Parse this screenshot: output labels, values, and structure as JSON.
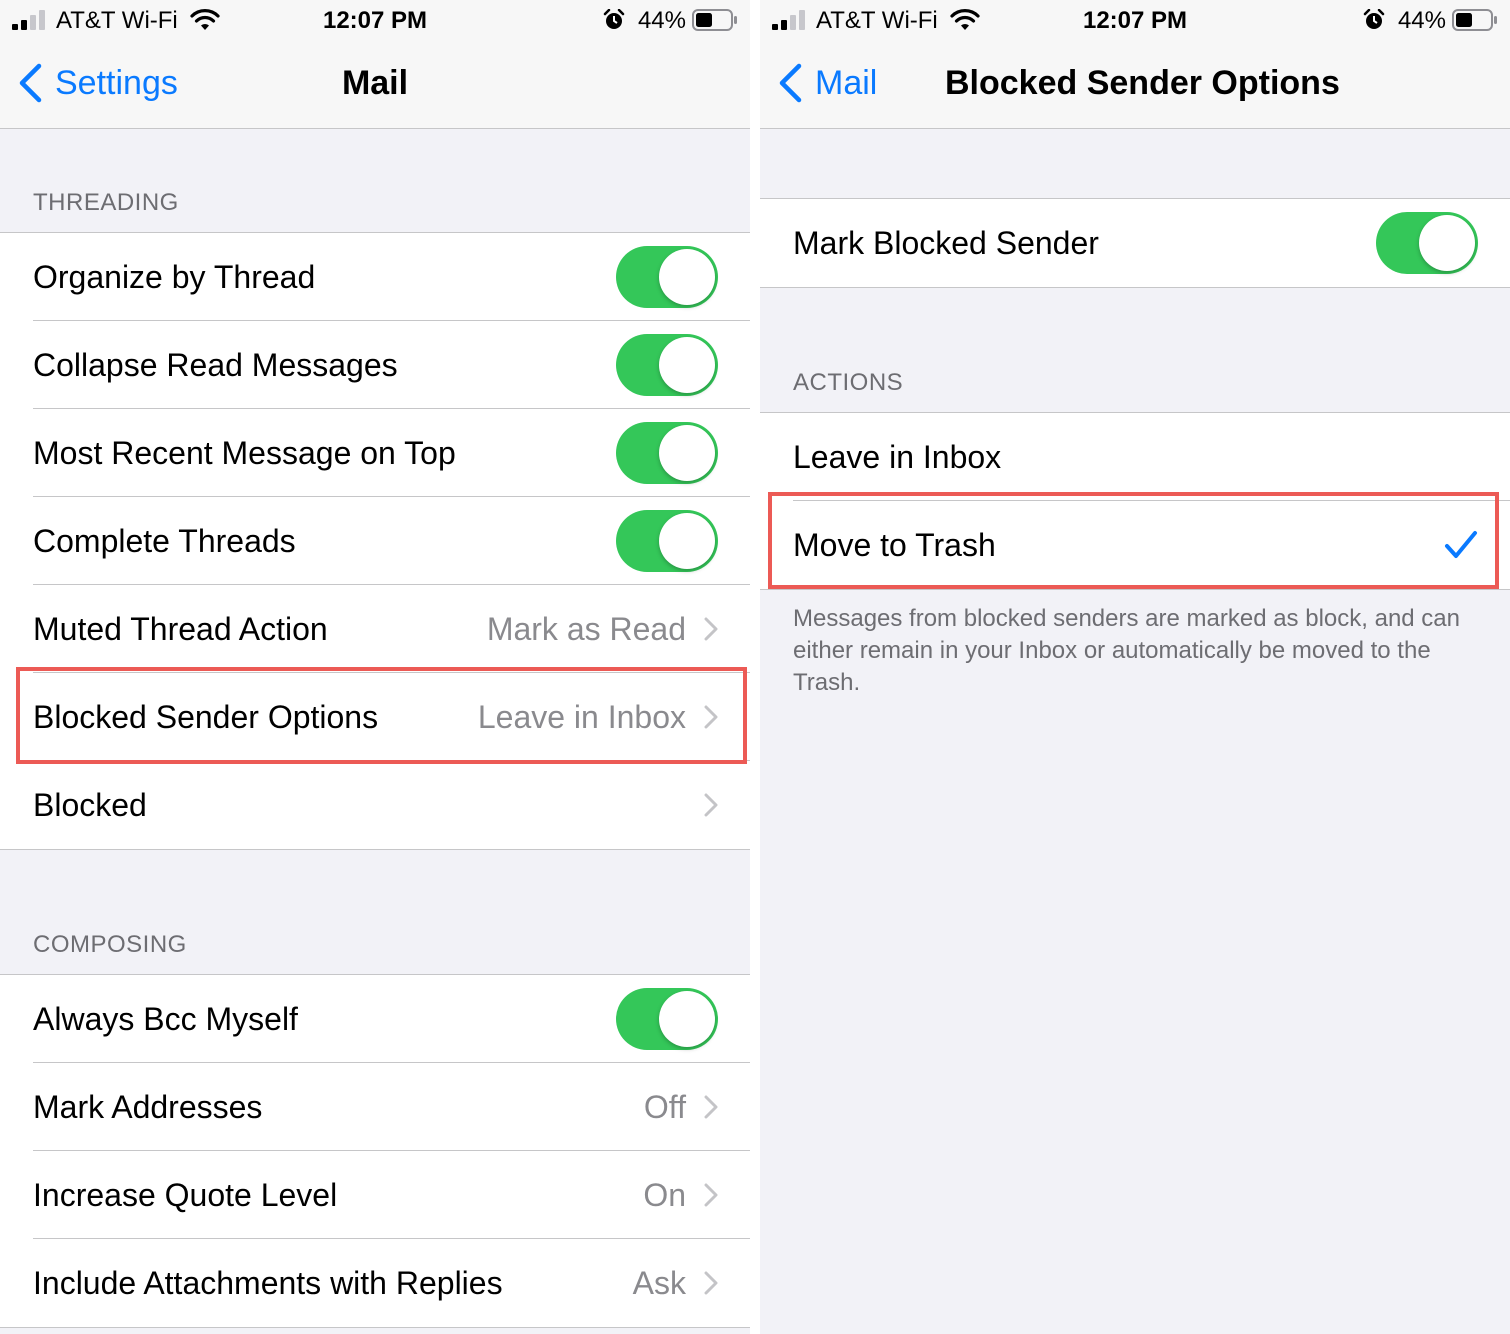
{
  "colors": {
    "accent": "#0a7aff",
    "toggle_on": "#34c759",
    "highlight": "#ec5a55"
  },
  "left": {
    "status": {
      "carrier": "AT&T Wi-Fi",
      "time": "12:07 PM",
      "battery": "44%"
    },
    "nav": {
      "back_label": "Settings",
      "title": "Mail"
    },
    "threading": {
      "header": "THREADING",
      "items": [
        {
          "label": "Organize by Thread",
          "toggle": true
        },
        {
          "label": "Collapse Read Messages",
          "toggle": true
        },
        {
          "label": "Most Recent Message on Top",
          "toggle": true
        },
        {
          "label": "Complete Threads",
          "toggle": true
        },
        {
          "label": "Muted Thread Action",
          "value": "Mark as Read"
        },
        {
          "label": "Blocked Sender Options",
          "value": "Leave in Inbox"
        },
        {
          "label": "Blocked",
          "value": ""
        }
      ]
    },
    "composing": {
      "header": "COMPOSING",
      "items": [
        {
          "label": "Always Bcc Myself",
          "toggle": true
        },
        {
          "label": "Mark Addresses",
          "value": "Off"
        },
        {
          "label": "Increase Quote Level",
          "value": "On"
        },
        {
          "label": "Include Attachments with Replies",
          "value": "Ask"
        }
      ]
    }
  },
  "right": {
    "status": {
      "carrier": "AT&T Wi-Fi",
      "time": "12:07 PM",
      "battery": "44%"
    },
    "nav": {
      "back_label": "Mail",
      "title": "Blocked Sender Options"
    },
    "mark": {
      "label": "Mark Blocked Sender",
      "toggle": true
    },
    "actions": {
      "header": "ACTIONS",
      "items": [
        {
          "label": "Leave in Inbox",
          "checked": false
        },
        {
          "label": "Move to Trash",
          "checked": true
        }
      ],
      "footer": "Messages from blocked senders are marked as block, and can either remain in your Inbox or automatically be moved to the Trash."
    }
  }
}
